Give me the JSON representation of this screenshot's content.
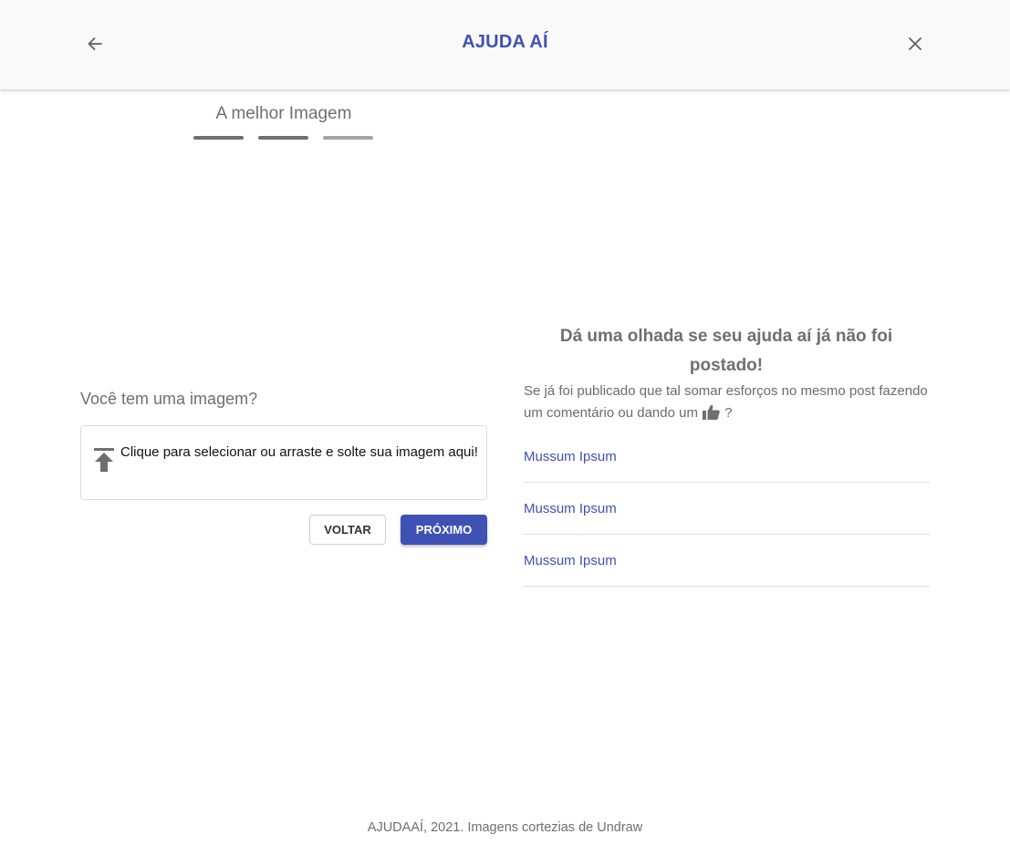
{
  "app_bar": {
    "title": "AJUDA AÍ",
    "back_icon": "arrow-left-icon",
    "close_icon": "close-icon"
  },
  "stepper": {
    "title": "A melhor Imagem",
    "steps": [
      {
        "state": "complete",
        "color": "#6f6f6f"
      },
      {
        "state": "complete",
        "color": "#6f6f6f"
      },
      {
        "state": "current",
        "color": "#a5a5a5"
      }
    ]
  },
  "upload": {
    "heading": "Você tem uma imagem?",
    "instruction": "Clique para selecionar ou arraste e solte sua imagem aqui!",
    "icon": "upload-icon"
  },
  "actions": {
    "back_label": "VOLTAR",
    "next_label": "PRÓXIMO"
  },
  "related": {
    "heading": "Dá uma olhada se seu ajuda aí já não foi postado!",
    "subtitle_before": "Se já foi publicado que tal somar esforços no mesmo post fazendo um comentário ou dando um",
    "subtitle_icon": "thumb-up-icon",
    "subtitle_after": "?",
    "posts": [
      {
        "title": "Mussum Ipsum"
      },
      {
        "title": "Mussum Ipsum"
      },
      {
        "title": "Mussum Ipsum"
      }
    ]
  },
  "footer": {
    "text": "AJUDAAÍ, 2021. Imagens cortezias de Undraw"
  },
  "colors": {
    "primary": "#3f51b5",
    "app_bar_bg": "#f9f9f9",
    "muted_text": "#6f6f6f"
  }
}
